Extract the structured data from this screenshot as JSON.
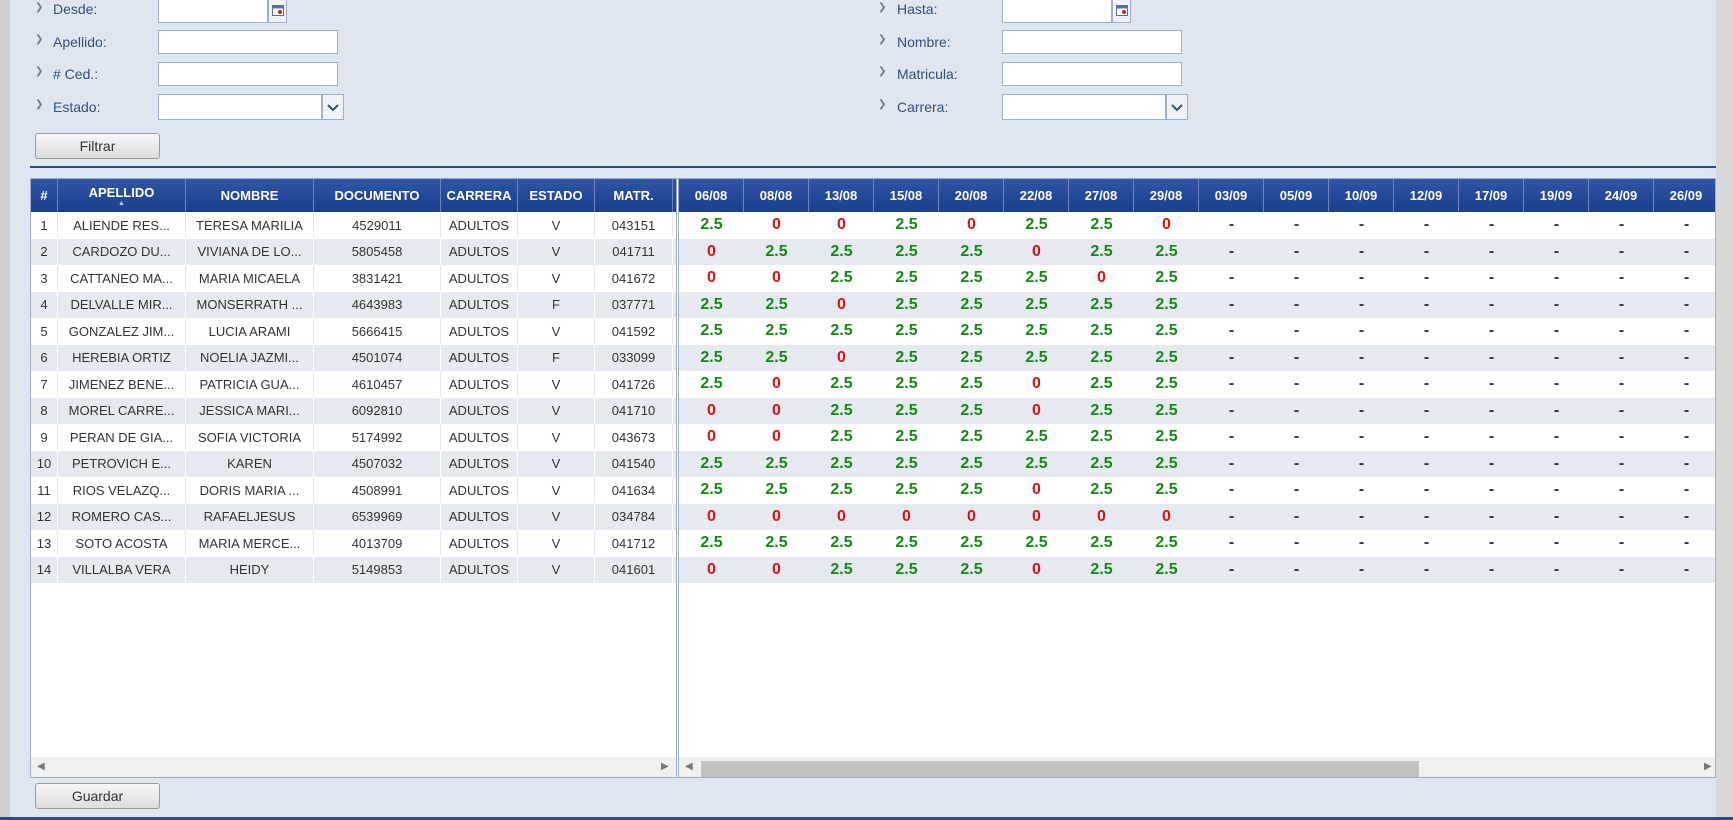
{
  "filters": {
    "desde_label": "Desde:",
    "hasta_label": "Hasta:",
    "apellido_label": "Apellido:",
    "nombre_label": "Nombre:",
    "ced_label": "# Ced.:",
    "matricula_label": "Matricula:",
    "estado_label": "Estado:",
    "carrera_label": "Carrera:",
    "filter_button": "Filtrar"
  },
  "table": {
    "headers": {
      "num": "#",
      "apellido": "APELLIDO",
      "nombre": "NOMBRE",
      "documento": "DOCUMENTO",
      "carrera": "CARRERA",
      "estado": "ESTADO",
      "matr": "MATR."
    },
    "dates": [
      "06/08",
      "08/08",
      "13/08",
      "15/08",
      "20/08",
      "22/08",
      "27/08",
      "29/08",
      "03/09",
      "05/09",
      "10/09",
      "12/09",
      "17/09",
      "19/09",
      "24/09",
      "26/09"
    ],
    "rows": [
      {
        "num": "1",
        "apellido": "ALIENDE RES...",
        "nombre": "TERESA MARILIA",
        "documento": "4529011",
        "carrera": "ADULTOS",
        "estado": "V",
        "matr": "043151",
        "grades": [
          "2.5",
          "0",
          "0",
          "2.5",
          "0",
          "2.5",
          "2.5",
          "0",
          "-",
          "-",
          "-",
          "-",
          "-",
          "-",
          "-",
          "-"
        ]
      },
      {
        "num": "2",
        "apellido": "CARDOZO DU...",
        "nombre": "VIVIANA DE LO...",
        "documento": "5805458",
        "carrera": "ADULTOS",
        "estado": "V",
        "matr": "041711",
        "grades": [
          "0",
          "2.5",
          "2.5",
          "2.5",
          "2.5",
          "0",
          "2.5",
          "2.5",
          "-",
          "-",
          "-",
          "-",
          "-",
          "-",
          "-",
          "-"
        ]
      },
      {
        "num": "3",
        "apellido": "CATTANEO MA...",
        "nombre": "MARIA MICAELA",
        "documento": "3831421",
        "carrera": "ADULTOS",
        "estado": "V",
        "matr": "041672",
        "grades": [
          "0",
          "0",
          "2.5",
          "2.5",
          "2.5",
          "2.5",
          "0",
          "2.5",
          "-",
          "-",
          "-",
          "-",
          "-",
          "-",
          "-",
          "-"
        ]
      },
      {
        "num": "4",
        "apellido": "DELVALLE MIR...",
        "nombre": "MONSERRATH ...",
        "documento": "4643983",
        "carrera": "ADULTOS",
        "estado": "F",
        "matr": "037771",
        "grades": [
          "2.5",
          "2.5",
          "0",
          "2.5",
          "2.5",
          "2.5",
          "2.5",
          "2.5",
          "-",
          "-",
          "-",
          "-",
          "-",
          "-",
          "-",
          "-"
        ]
      },
      {
        "num": "5",
        "apellido": "GONZALEZ JIM...",
        "nombre": "LUCIA ARAMI",
        "documento": "5666415",
        "carrera": "ADULTOS",
        "estado": "V",
        "matr": "041592",
        "grades": [
          "2.5",
          "2.5",
          "2.5",
          "2.5",
          "2.5",
          "2.5",
          "2.5",
          "2.5",
          "-",
          "-",
          "-",
          "-",
          "-",
          "-",
          "-",
          "-"
        ]
      },
      {
        "num": "6",
        "apellido": "HEREBIA ORTIZ",
        "nombre": "NOELIA JAZMI...",
        "documento": "4501074",
        "carrera": "ADULTOS",
        "estado": "F",
        "matr": "033099",
        "grades": [
          "2.5",
          "2.5",
          "0",
          "2.5",
          "2.5",
          "2.5",
          "2.5",
          "2.5",
          "-",
          "-",
          "-",
          "-",
          "-",
          "-",
          "-",
          "-"
        ]
      },
      {
        "num": "7",
        "apellido": "JIMENEZ BENE...",
        "nombre": "PATRICIA GUA...",
        "documento": "4610457",
        "carrera": "ADULTOS",
        "estado": "V",
        "matr": "041726",
        "grades": [
          "2.5",
          "0",
          "2.5",
          "2.5",
          "2.5",
          "0",
          "2.5",
          "2.5",
          "-",
          "-",
          "-",
          "-",
          "-",
          "-",
          "-",
          "-"
        ]
      },
      {
        "num": "8",
        "apellido": "MOREL CARRE...",
        "nombre": "JESSICA MARI...",
        "documento": "6092810",
        "carrera": "ADULTOS",
        "estado": "V",
        "matr": "041710",
        "grades": [
          "0",
          "0",
          "2.5",
          "2.5",
          "2.5",
          "0",
          "2.5",
          "2.5",
          "-",
          "-",
          "-",
          "-",
          "-",
          "-",
          "-",
          "-"
        ]
      },
      {
        "num": "9",
        "apellido": "PERAN DE GIA...",
        "nombre": "SOFIA VICTORIA",
        "documento": "5174992",
        "carrera": "ADULTOS",
        "estado": "V",
        "matr": "043673",
        "grades": [
          "0",
          "0",
          "2.5",
          "2.5",
          "2.5",
          "2.5",
          "2.5",
          "2.5",
          "-",
          "-",
          "-",
          "-",
          "-",
          "-",
          "-",
          "-"
        ]
      },
      {
        "num": "10",
        "apellido": "PETROVICH E...",
        "nombre": "KAREN",
        "documento": "4507032",
        "carrera": "ADULTOS",
        "estado": "V",
        "matr": "041540",
        "grades": [
          "2.5",
          "2.5",
          "2.5",
          "2.5",
          "2.5",
          "2.5",
          "2.5",
          "2.5",
          "-",
          "-",
          "-",
          "-",
          "-",
          "-",
          "-",
          "-"
        ]
      },
      {
        "num": "11",
        "apellido": "RIOS VELAZQ...",
        "nombre": "DORIS MARIA ...",
        "documento": "4508991",
        "carrera": "ADULTOS",
        "estado": "V",
        "matr": "041634",
        "grades": [
          "2.5",
          "2.5",
          "2.5",
          "2.5",
          "2.5",
          "0",
          "2.5",
          "2.5",
          "-",
          "-",
          "-",
          "-",
          "-",
          "-",
          "-",
          "-"
        ]
      },
      {
        "num": "12",
        "apellido": "ROMERO CAS...",
        "nombre": "RAFAELJESUS",
        "documento": "6539969",
        "carrera": "ADULTOS",
        "estado": "V",
        "matr": "034784",
        "grades": [
          "0",
          "0",
          "0",
          "0",
          "0",
          "0",
          "0",
          "0",
          "-",
          "-",
          "-",
          "-",
          "-",
          "-",
          "-",
          "-"
        ]
      },
      {
        "num": "13",
        "apellido": "SOTO ACOSTA",
        "nombre": "MARIA MERCE...",
        "documento": "4013709",
        "carrera": "ADULTOS",
        "estado": "V",
        "matr": "041712",
        "grades": [
          "2.5",
          "2.5",
          "2.5",
          "2.5",
          "2.5",
          "2.5",
          "2.5",
          "2.5",
          "-",
          "-",
          "-",
          "-",
          "-",
          "-",
          "-",
          "-"
        ]
      },
      {
        "num": "14",
        "apellido": "VILLALBA VERA",
        "nombre": "HEIDY",
        "documento": "5149853",
        "carrera": "ADULTOS",
        "estado": "V",
        "matr": "041601",
        "grades": [
          "0",
          "0",
          "2.5",
          "2.5",
          "2.5",
          "0",
          "2.5",
          "2.5",
          "-",
          "-",
          "-",
          "-",
          "-",
          "-",
          "-",
          "-"
        ]
      }
    ]
  },
  "actions": {
    "save_button": "Guardar"
  },
  "colors": {
    "header_bg": "#1f4494",
    "grade_pass": "#138a13",
    "grade_zero": "#e01010"
  }
}
